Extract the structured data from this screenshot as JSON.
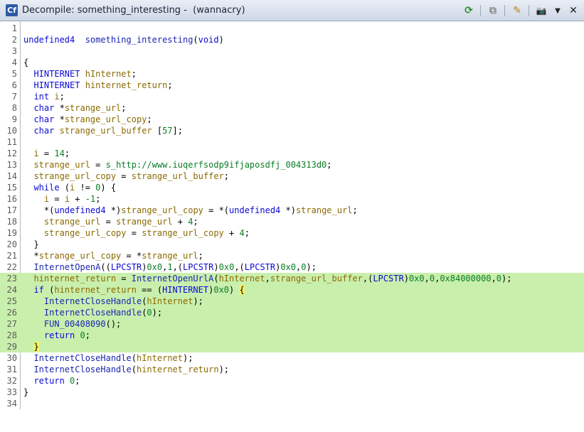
{
  "window": {
    "title": "Decompile: something_interesting -  (wannacry)",
    "app_icon": "Cf"
  },
  "toolbar": [
    {
      "name": "refresh-icon",
      "glyph": "⟳"
    },
    {
      "name": "copy-icon",
      "glyph": "⧉"
    },
    {
      "name": "edit-icon",
      "glyph": "✎"
    },
    {
      "name": "snapshot-icon",
      "glyph": "📷"
    },
    {
      "name": "menu-dropdown-icon",
      "glyph": "▼"
    },
    {
      "name": "close-icon",
      "glyph": "✕"
    }
  ],
  "colors": {
    "highlight": "#c9efad",
    "keyword": "#0a0ad6",
    "variable": "#8a6a00",
    "number": "#0a7d26"
  },
  "highlighted_lines": [
    23,
    24,
    25,
    26,
    27,
    28,
    29
  ],
  "lines": [
    [],
    [
      [
        "ty",
        "undefined4"
      ],
      [
        "",
        "  "
      ],
      [
        "fn",
        "something_interesting"
      ],
      [
        "",
        "("
      ],
      [
        "ty",
        "void"
      ],
      [
        "",
        ")"
      ]
    ],
    [],
    [
      [
        "",
        "{"
      ]
    ],
    [
      [
        "",
        "  "
      ],
      [
        "ty",
        "HINTERNET"
      ],
      [
        "",
        " "
      ],
      [
        "var",
        "hInternet"
      ],
      [
        "",
        ";"
      ]
    ],
    [
      [
        "",
        "  "
      ],
      [
        "ty",
        "HINTERNET"
      ],
      [
        "",
        " "
      ],
      [
        "var",
        "hinternet_return"
      ],
      [
        "",
        ";"
      ]
    ],
    [
      [
        "",
        "  "
      ],
      [
        "ty",
        "int"
      ],
      [
        "",
        " "
      ],
      [
        "var",
        "i"
      ],
      [
        "",
        ";"
      ]
    ],
    [
      [
        "",
        "  "
      ],
      [
        "ty",
        "char"
      ],
      [
        "",
        " *"
      ],
      [
        "var",
        "strange_url"
      ],
      [
        "",
        ";"
      ]
    ],
    [
      [
        "",
        "  "
      ],
      [
        "ty",
        "char"
      ],
      [
        "",
        " *"
      ],
      [
        "var",
        "strange_url_copy"
      ],
      [
        "",
        ";"
      ]
    ],
    [
      [
        "",
        "  "
      ],
      [
        "ty",
        "char"
      ],
      [
        "",
        " "
      ],
      [
        "var",
        "strange_url_buffer"
      ],
      [
        "",
        " ["
      ],
      [
        "num",
        "57"
      ],
      [
        "",
        "];"
      ]
    ],
    [],
    [
      [
        "",
        "  "
      ],
      [
        "var",
        "i"
      ],
      [
        "",
        " = "
      ],
      [
        "num",
        "14"
      ],
      [
        "",
        ";"
      ]
    ],
    [
      [
        "",
        "  "
      ],
      [
        "var",
        "strange_url"
      ],
      [
        "",
        " = "
      ],
      [
        "str",
        "s_http://www.iuqerfsodp9ifjaposdfj_004313d0"
      ],
      [
        "",
        ";"
      ]
    ],
    [
      [
        "",
        "  "
      ],
      [
        "var",
        "strange_url_copy"
      ],
      [
        "",
        " = "
      ],
      [
        "var",
        "strange_url_buffer"
      ],
      [
        "",
        ";"
      ]
    ],
    [
      [
        "",
        "  "
      ],
      [
        "kw",
        "while"
      ],
      [
        "",
        " ("
      ],
      [
        "var",
        "i"
      ],
      [
        "",
        " != "
      ],
      [
        "num",
        "0"
      ],
      [
        "",
        ") {"
      ]
    ],
    [
      [
        "",
        "    "
      ],
      [
        "var",
        "i"
      ],
      [
        "",
        " = "
      ],
      [
        "var",
        "i"
      ],
      [
        "",
        " + "
      ],
      [
        "num",
        "-1"
      ],
      [
        "",
        ";"
      ]
    ],
    [
      [
        "",
        "    *("
      ],
      [
        "ty",
        "undefined4"
      ],
      [
        "",
        " *)"
      ],
      [
        "var",
        "strange_url_copy"
      ],
      [
        "",
        " = *("
      ],
      [
        "ty",
        "undefined4"
      ],
      [
        "",
        " *)"
      ],
      [
        "var",
        "strange_url"
      ],
      [
        "",
        ";"
      ]
    ],
    [
      [
        "",
        "    "
      ],
      [
        "var",
        "strange_url"
      ],
      [
        "",
        " = "
      ],
      [
        "var",
        "strange_url"
      ],
      [
        "",
        " + "
      ],
      [
        "num",
        "4"
      ],
      [
        "",
        ";"
      ]
    ],
    [
      [
        "",
        "    "
      ],
      [
        "var",
        "strange_url_copy"
      ],
      [
        "",
        " = "
      ],
      [
        "var",
        "strange_url_copy"
      ],
      [
        "",
        " + "
      ],
      [
        "num",
        "4"
      ],
      [
        "",
        ";"
      ]
    ],
    [
      [
        "",
        "  }"
      ]
    ],
    [
      [
        "",
        "  *"
      ],
      [
        "var",
        "strange_url_copy"
      ],
      [
        "",
        " = *"
      ],
      [
        "var",
        "strange_url"
      ],
      [
        "",
        ";"
      ]
    ],
    [
      [
        "",
        "  "
      ],
      [
        "fn",
        "InternetOpenA"
      ],
      [
        "",
        "(("
      ],
      [
        "ty",
        "LPCSTR"
      ],
      [
        "",
        ")"
      ],
      [
        "num",
        "0x0"
      ],
      [
        "",
        ","
      ],
      [
        "num",
        "1"
      ],
      [
        "",
        ",("
      ],
      [
        "ty",
        "LPCSTR"
      ],
      [
        "",
        ")"
      ],
      [
        "num",
        "0x0"
      ],
      [
        "",
        ",("
      ],
      [
        "ty",
        "LPCSTR"
      ],
      [
        "",
        ")"
      ],
      [
        "num",
        "0x0"
      ],
      [
        "",
        ","
      ],
      [
        "num",
        "0"
      ],
      [
        "",
        ");"
      ]
    ],
    [
      [
        "",
        "  "
      ],
      [
        "var",
        "hinternet_return"
      ],
      [
        "",
        " = "
      ],
      [
        "fn",
        "InternetOpenUrlA"
      ],
      [
        "",
        "("
      ],
      [
        "var",
        "hInternet"
      ],
      [
        "",
        ","
      ],
      [
        "var",
        "strange_url_buffer"
      ],
      [
        "",
        ",("
      ],
      [
        "ty",
        "LPCSTR"
      ],
      [
        "",
        ")"
      ],
      [
        "num",
        "0x0"
      ],
      [
        "",
        ","
      ],
      [
        "num",
        "0"
      ],
      [
        "",
        ","
      ],
      [
        "num",
        "0x84000000"
      ],
      [
        "",
        ","
      ],
      [
        "num",
        "0"
      ],
      [
        "",
        ");"
      ]
    ],
    [
      [
        "",
        "  "
      ],
      [
        "kw",
        "if"
      ],
      [
        "",
        " ("
      ],
      [
        "var",
        "hinternet_return"
      ],
      [
        "",
        " == ("
      ],
      [
        "ty",
        "HINTERNET"
      ],
      [
        "",
        ")"
      ],
      [
        "num",
        "0x0"
      ],
      [
        "",
        ") "
      ],
      [
        "brace",
        "{"
      ]
    ],
    [
      [
        "",
        "    "
      ],
      [
        "fn",
        "InternetCloseHandle"
      ],
      [
        "",
        "("
      ],
      [
        "var",
        "hInternet"
      ],
      [
        "",
        ");"
      ]
    ],
    [
      [
        "",
        "    "
      ],
      [
        "fn",
        "InternetCloseHandle"
      ],
      [
        "",
        "("
      ],
      [
        "num",
        "0"
      ],
      [
        "",
        ");"
      ]
    ],
    [
      [
        "",
        "    "
      ],
      [
        "fn",
        "FUN_00408090"
      ],
      [
        "",
        "();"
      ]
    ],
    [
      [
        "",
        "    "
      ],
      [
        "kw",
        "return"
      ],
      [
        "",
        " "
      ],
      [
        "num",
        "0"
      ],
      [
        "",
        ";"
      ]
    ],
    [
      [
        "",
        "  "
      ],
      [
        "brace",
        "}"
      ]
    ],
    [
      [
        "",
        "  "
      ],
      [
        "fn",
        "InternetCloseHandle"
      ],
      [
        "",
        "("
      ],
      [
        "var",
        "hInternet"
      ],
      [
        "",
        ");"
      ]
    ],
    [
      [
        "",
        "  "
      ],
      [
        "fn",
        "InternetCloseHandle"
      ],
      [
        "",
        "("
      ],
      [
        "var",
        "hinternet_return"
      ],
      [
        "",
        ");"
      ]
    ],
    [
      [
        "",
        "  "
      ],
      [
        "kw",
        "return"
      ],
      [
        "",
        " "
      ],
      [
        "num",
        "0"
      ],
      [
        "",
        ";"
      ]
    ],
    [
      [
        "",
        "}"
      ]
    ],
    []
  ]
}
